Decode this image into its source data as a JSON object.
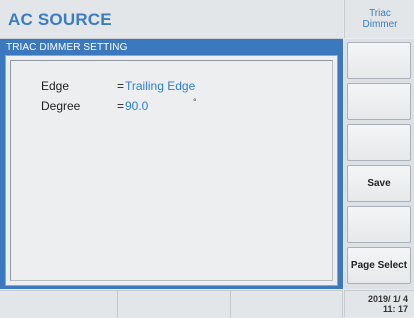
{
  "header": {
    "title": "AC SOURCE",
    "mode_line1": "Triac",
    "mode_line2": "Dimmer"
  },
  "panel": {
    "title": "TRIAC DIMMER SETTING",
    "rows": [
      {
        "label": "Edge",
        "eq": "=",
        "value": "Trailing  Edge",
        "unit": ""
      },
      {
        "label": "Degree",
        "eq": "=",
        "value": "90.0",
        "unit": "°"
      }
    ]
  },
  "softkeys": [
    "",
    "",
    "",
    "Save",
    "",
    "Page Select"
  ],
  "status": {
    "date": "2019/ 1/ 4",
    "time": "11: 17"
  },
  "colors": {
    "accent": "#3a7dc0",
    "panel_blue": "#3b78bd",
    "value_text": "#2f7fd0"
  }
}
